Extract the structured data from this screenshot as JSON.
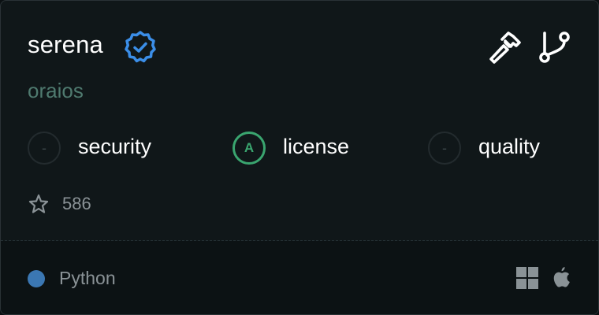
{
  "repo": {
    "name": "serena",
    "owner": "oraios",
    "verified": true
  },
  "actions": {
    "tools_icon": "hammer-icon",
    "fork_icon": "git-branch-icon"
  },
  "metrics": [
    {
      "label": "security",
      "grade": "-"
    },
    {
      "label": "license",
      "grade": "A"
    },
    {
      "label": "quality",
      "grade": "-"
    }
  ],
  "stars": "586",
  "language": {
    "name": "Python",
    "color": "#3b77b3"
  },
  "platforms": [
    "windows-icon",
    "apple-icon"
  ],
  "colors": {
    "verified": "#3b8ee8",
    "grade_a": "#3aa56f",
    "owner": "#4f7a6f"
  }
}
